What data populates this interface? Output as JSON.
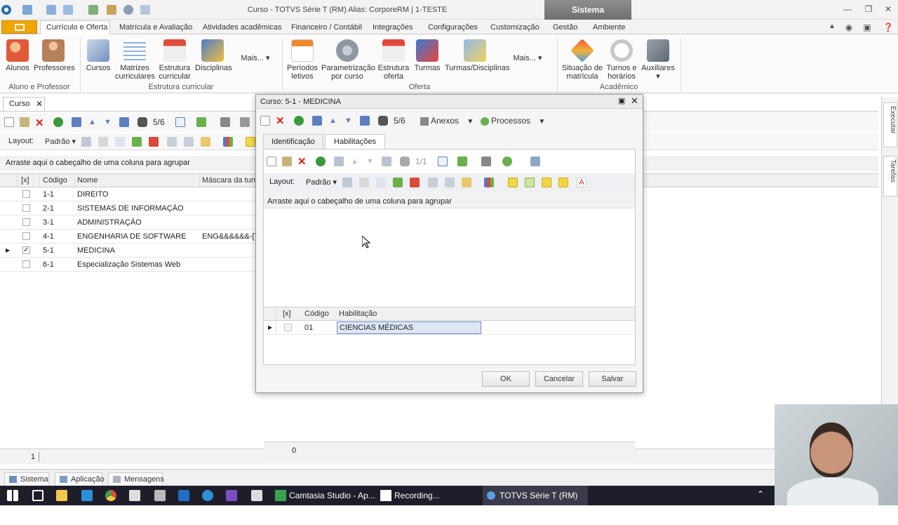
{
  "window": {
    "title": "Curso - TOTVS Série T  (RM) Alias: CorporeRM | 1-TESTE",
    "context_tab": "Sistema"
  },
  "ribbon_tabs": [
    "Currículo e Oferta",
    "Matrícula e Avaliação",
    "Atividades acadêmicas",
    "Financeiro / Contábil",
    "Integrações",
    "Configurações",
    "Customização",
    "Gestão",
    "Ambiente"
  ],
  "ribbon": {
    "alunos": "Alunos",
    "professores": "Professores",
    "cursos": "Cursos",
    "matrizes": "Matrizes curriculares",
    "estrutura_curricular": "Estrutura curricular",
    "disciplinas": "Disciplinas",
    "mais1": "Mais...",
    "periodos": "Períodos letivos",
    "parametrizacao": "Parametrização por curso",
    "estrutura_oferta": "Estrutura oferta",
    "turmas": "Turmas",
    "turmas_disciplinas": "Turmas/Disciplinas",
    "mais2": "Mais...",
    "situacao": "Situação de matrícula",
    "turnos": "Turnos e horários",
    "auxiliares": "Auxiliares",
    "groups": {
      "aluno_professor": "Aluno e Professor",
      "estrutura_curricular": "Estrutura curricular",
      "oferta": "Oferta",
      "academico": "Acadêmico"
    }
  },
  "doc_tab": {
    "label": "Curso"
  },
  "main_toolbar": {
    "counter": "5/6",
    "layout_label": "Layout:",
    "layout_value": "Padrão"
  },
  "main_grid": {
    "group_hint": "Arraste aqui o cabeçalho de uma coluna para agrupar",
    "columns": [
      "[x]",
      "Código",
      "Nome",
      "Máscara da turm"
    ],
    "rows": [
      {
        "code": "1-1",
        "name": "DIREITO",
        "mask": "",
        "checked": false
      },
      {
        "code": "2-1",
        "name": "SISTEMAS DE INFORMAÇÃO",
        "mask": "",
        "checked": false
      },
      {
        "code": "3-1",
        "name": "ADMINISTRAÇÃO",
        "mask": "",
        "checked": false
      },
      {
        "code": "4-1",
        "name": "ENGENHARIA DE SOFTWARE",
        "mask": "ENG&&&&&&-[T]",
        "checked": false
      },
      {
        "code": "5-1",
        "name": "MEDICINA",
        "mask": "",
        "checked": true
      },
      {
        "code": "6-1",
        "name": "Especialização Sistemas Web",
        "mask": "",
        "checked": false
      }
    ],
    "footer_count": "1"
  },
  "side_tabs": [
    "Executar",
    "Tarefas"
  ],
  "bottom_tabs": [
    "Sistema",
    "Aplicação",
    "Mensagens"
  ],
  "dialog": {
    "title": "Curso: 5-1 - MEDICINA",
    "counter": "5/6",
    "anexos": "Anexos",
    "processos": "Processos",
    "tabs": [
      "Identificação",
      "Habilitações"
    ],
    "inner_counter": "1/1",
    "layout_label": "Layout:",
    "layout_value": "Padrão",
    "group_hint": "Arraste aqui o cabeçalho de uma coluna para agrupar",
    "columns": [
      "[x]",
      "Código",
      "Habilitação"
    ],
    "rows": [
      {
        "code": "01",
        "name": "CIENCIAS MÉDICAS"
      }
    ],
    "footer_count": "0",
    "buttons": {
      "ok": "OK",
      "cancel": "Cancelar",
      "save": "Salvar"
    }
  },
  "taskbar": {
    "camtasia": "Camtasia Studio - Ap...",
    "recording": "Recording...",
    "totvs": "TOTVS Série T  (RM) A..."
  }
}
